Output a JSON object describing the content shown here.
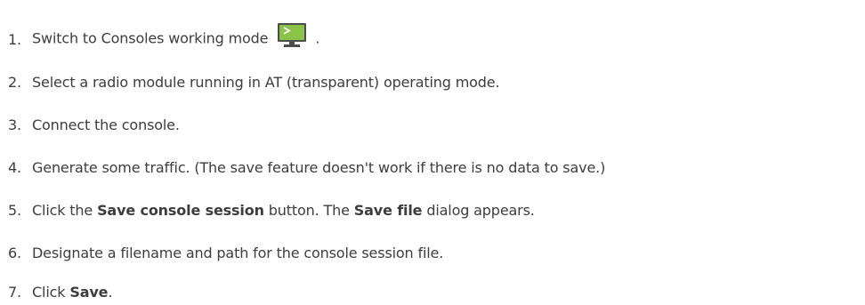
{
  "steps": [
    {
      "number": "1.",
      "parts": {
        "a": "Switch to Consoles working mode",
        "b": "."
      },
      "icon": "consoles-mode-icon"
    },
    {
      "number": "2.",
      "parts": {
        "a": "Select a radio module running in AT (transparent) operating mode."
      }
    },
    {
      "number": "3.",
      "parts": {
        "a": "Connect the console."
      }
    },
    {
      "number": "4.",
      "parts": {
        "a": "Generate some traffic. (The save feature doesn't work if there is no data to save.)"
      }
    },
    {
      "number": "5.",
      "parts": {
        "a": "Click the",
        "b": "Save console session",
        "c": "button. The",
        "d": "Save file",
        "e": "dialog appears."
      }
    },
    {
      "number": "6.",
      "parts": {
        "a": "Designate a filename and path for the console session file."
      }
    },
    {
      "number": "7.",
      "parts": {
        "a": "Click",
        "b": "Save",
        "c": "."
      }
    }
  ],
  "colors": {
    "text": "#3d3d3d",
    "icon_screen": "#8bc34a",
    "icon_base": "#4d4d4d"
  }
}
